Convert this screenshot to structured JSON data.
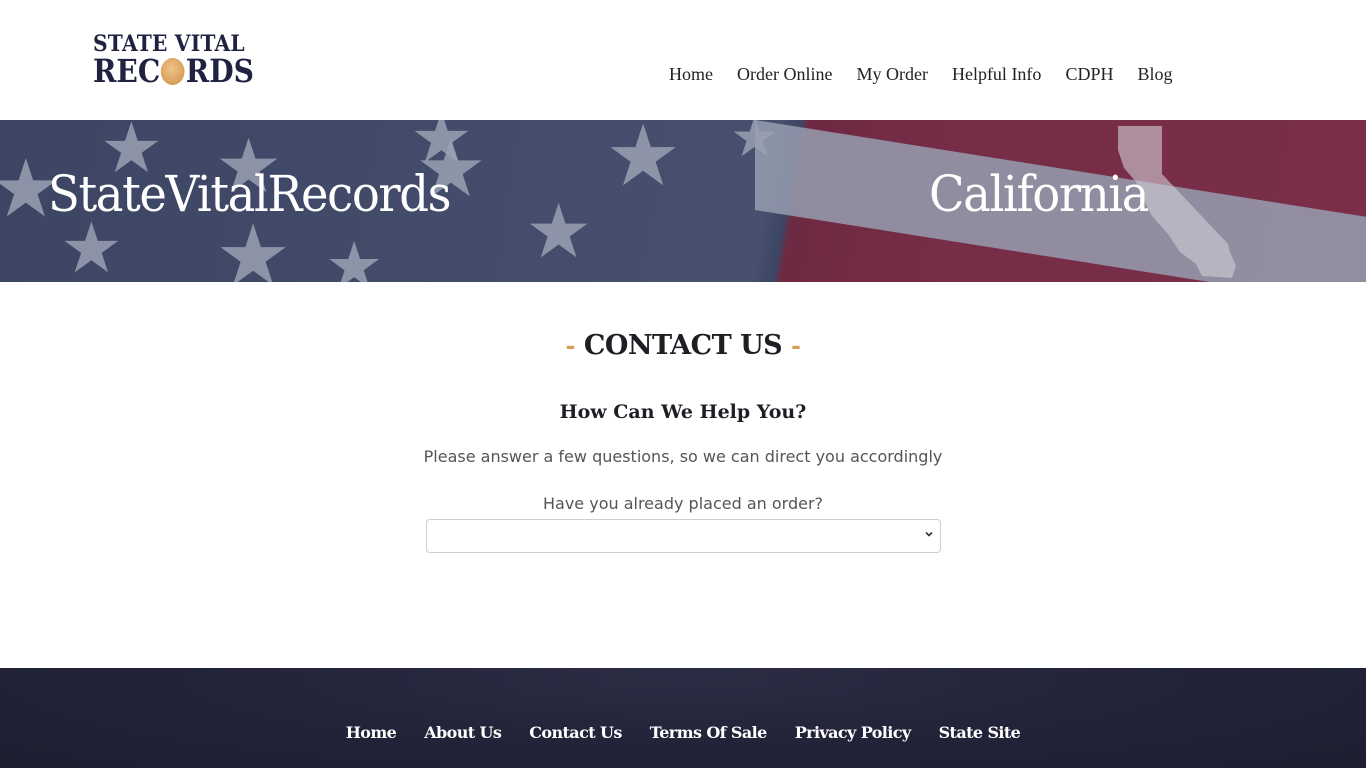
{
  "header": {
    "logo": {
      "line1": "STATE VITAL",
      "line2_prefix": "REC",
      "line2_suffix": "RDS",
      "seal_icon": "gold-seal-icon",
      "seal_color": "#d9a15c",
      "text_color": "#1f2240"
    },
    "nav": [
      {
        "label": "Home"
      },
      {
        "label": "Order Online"
      },
      {
        "label": "My Order"
      },
      {
        "label": "Helpful Info"
      },
      {
        "label": "CDPH"
      },
      {
        "label": "Blog"
      }
    ]
  },
  "banner": {
    "left_title": "StateVitalRecords",
    "right_title": "California",
    "background_icon": "american-flag",
    "map_icon": "california-map-icon"
  },
  "main": {
    "section_title": "CONTACT US",
    "title_dash": "-",
    "accent_color": "#d4a05a",
    "help_title": "How Can We Help You?",
    "help_description": "Please answer a few questions, so we can direct you accordingly",
    "question_label": "Have you already placed an order?",
    "order_select": {
      "value": "",
      "icon": "chevron-down-icon"
    }
  },
  "footer": {
    "background_color": "#23243a",
    "nav": [
      {
        "label": "Home"
      },
      {
        "label": "About Us"
      },
      {
        "label": "Contact Us"
      },
      {
        "label": "Terms Of Sale"
      },
      {
        "label": "Privacy Policy"
      },
      {
        "label": "State Site"
      }
    ]
  }
}
